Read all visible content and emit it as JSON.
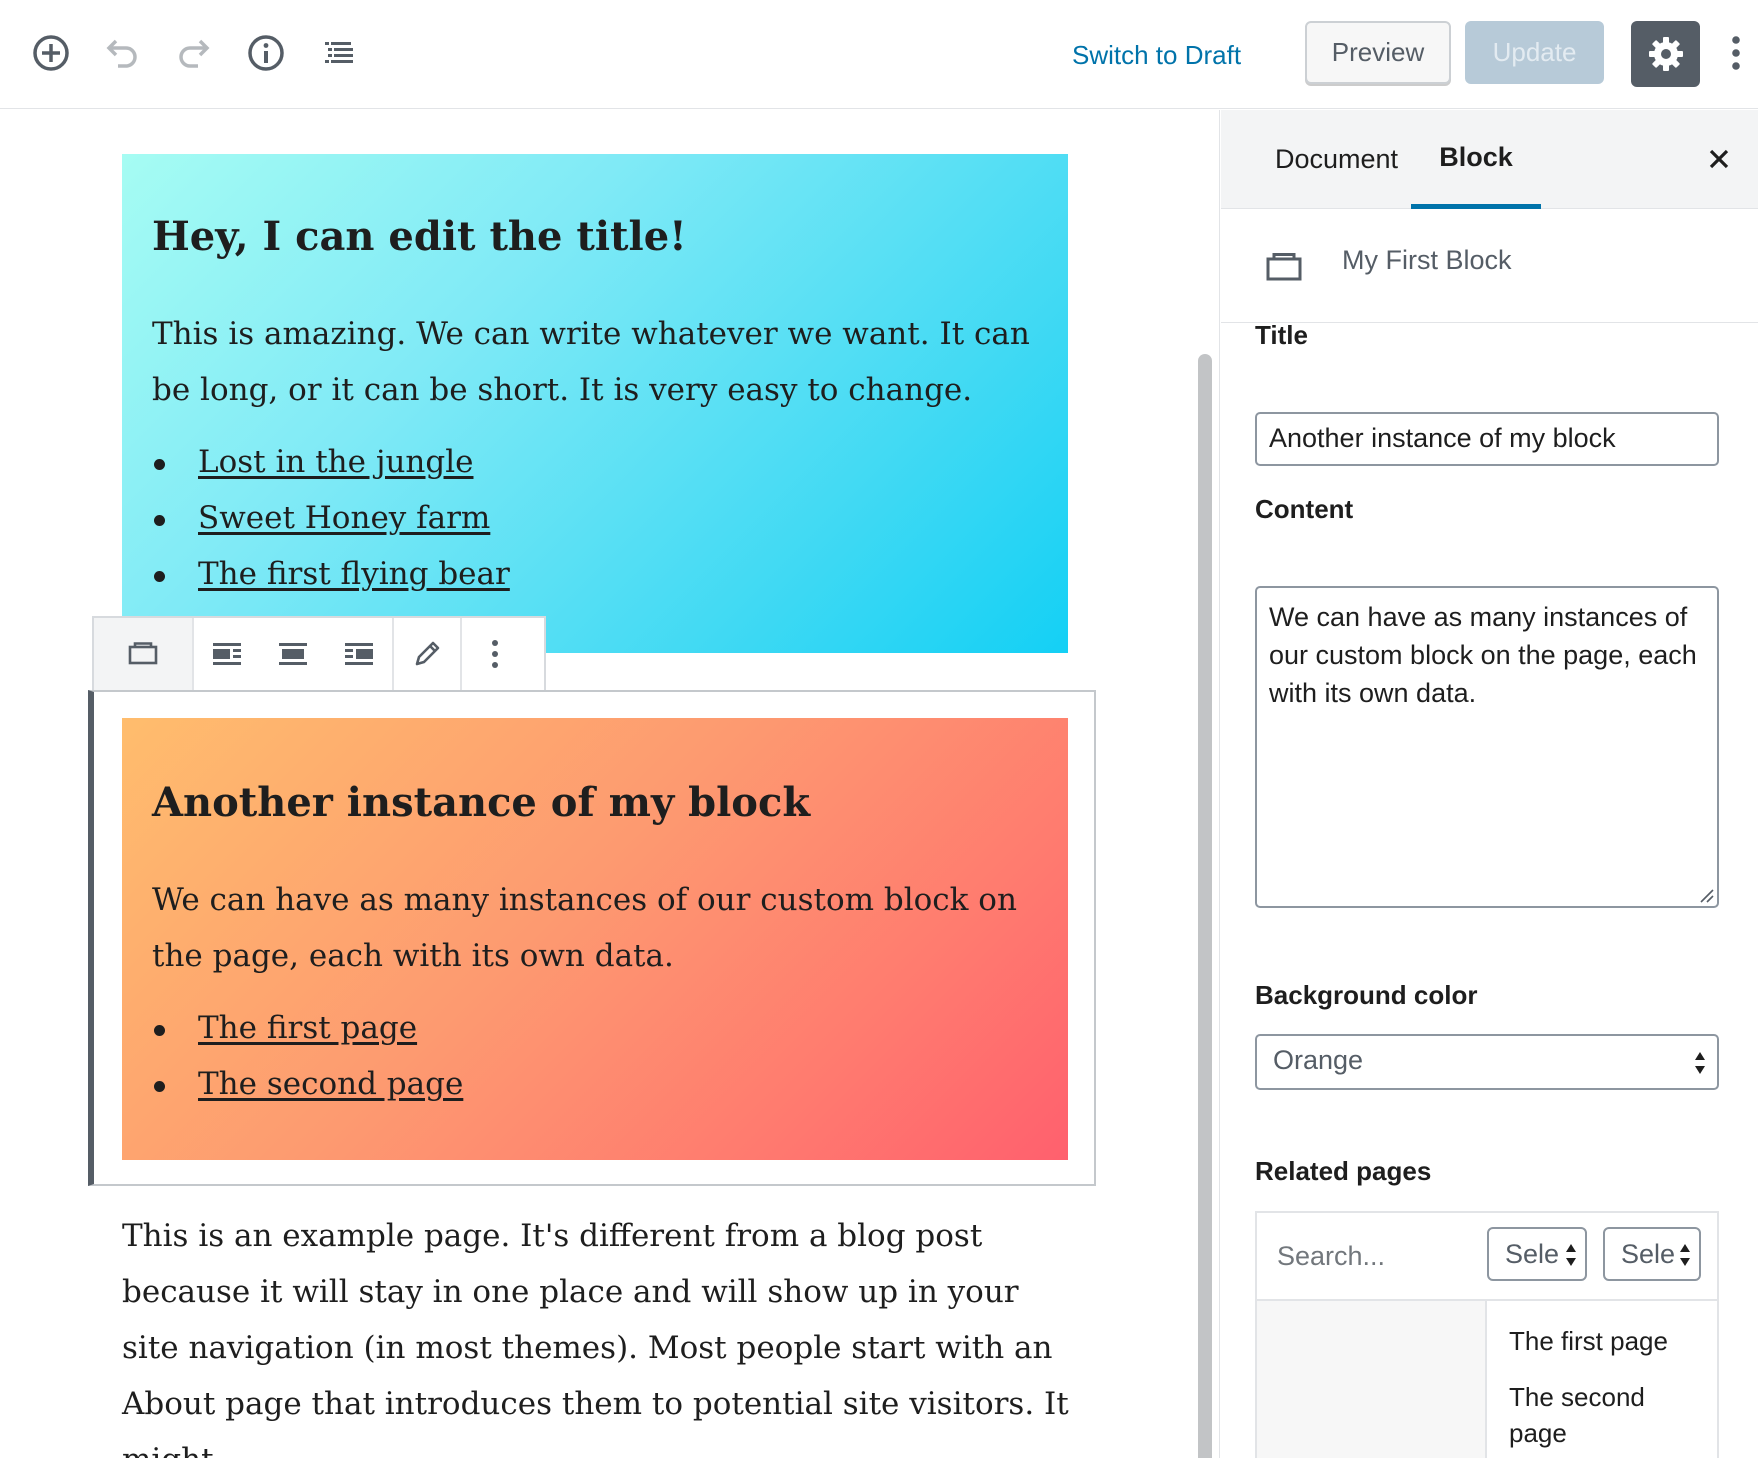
{
  "toolbar": {
    "add_icon": "plus-circle-icon",
    "undo_icon": "undo-icon",
    "redo_icon": "redo-icon",
    "info_icon": "info-icon",
    "outline_icon": "list-outline-icon",
    "switch_to_draft": "Switch to Draft",
    "preview": "Preview",
    "update": "Update",
    "settings_icon": "gear-icon",
    "more_icon": "more-vertical-icon"
  },
  "editor": {
    "block1": {
      "title": "Hey, I can edit the title!",
      "content": "This is amazing. We can write whatever we want. It can be long, or it can be short. It is very easy to change.",
      "links": [
        "Lost in the jungle",
        "Sweet Honey farm",
        "The first flying bear"
      ],
      "gradient": [
        "#a6fcf3",
        "#14d0f5"
      ]
    },
    "block2": {
      "title": "Another instance of my block",
      "content": "We can have as many instances of our custom block on the page, each with its own data.",
      "links": [
        "The first page",
        "The second page"
      ],
      "gradient": [
        "#ffbd6d",
        "#ff606e"
      ]
    },
    "block_toolbar": {
      "block_icon": "block-card-icon",
      "align_left_icon": "align-left-icon",
      "align_center_icon": "align-center-icon",
      "align_right_icon": "align-right-icon",
      "edit_icon": "pencil-icon",
      "more_icon": "more-vertical-icon"
    },
    "page_text": "This is an example page. It's different from a blog post because it will stay in one place and will show up in your site navigation (in most themes). Most people start with an About page that introduces them to potential site visitors. It might"
  },
  "sidebar": {
    "tabs": [
      {
        "label": "Document",
        "active": false
      },
      {
        "label": "Block",
        "active": true
      }
    ],
    "close_icon": "close-icon",
    "block_card": {
      "icon": "block-card-icon",
      "name": "My First Block"
    },
    "title_label": "Title",
    "title_value": "Another instance of my block",
    "content_label": "Content",
    "content_value": "We can have as many instances of our custom block on the page, each with its own data.",
    "bg_label": "Background color",
    "bg_value": "Orange",
    "related_label": "Related pages",
    "related": {
      "search_placeholder": "Search...",
      "filter1": "Sele",
      "filter2": "Sele",
      "items": [
        "The first page",
        "The second page"
      ]
    }
  },
  "colors": {
    "accent": "#0073aa",
    "update_disabled": "#b7cad8",
    "settings_active": "#555d66"
  }
}
